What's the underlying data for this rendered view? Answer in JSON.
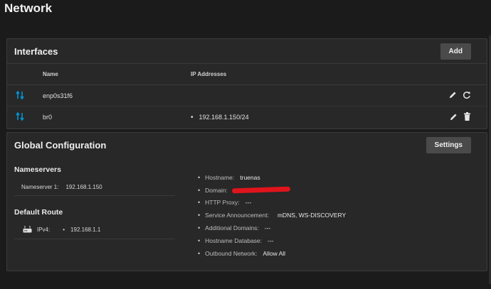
{
  "page": {
    "title": "Network"
  },
  "interfaces": {
    "title": "Interfaces",
    "add_label": "Add",
    "columns": {
      "name": "Name",
      "ip": "IP Addresses"
    },
    "rows": [
      {
        "name": "enp0s31f6",
        "ip": ""
      },
      {
        "name": "br0",
        "ip": "192.168.1.150/24"
      }
    ]
  },
  "global": {
    "title": "Global Configuration",
    "settings_label": "Settings",
    "nameservers": {
      "title": "Nameservers",
      "items": [
        {
          "label": "Nameserver 1:",
          "value": "192.168.1.150"
        }
      ]
    },
    "default_route": {
      "title": "Default Route",
      "label": "IPv4:",
      "value": "192.168.1.1"
    },
    "details": {
      "hostname": {
        "label": "Hostname:",
        "value": "truenas"
      },
      "domain": {
        "label": "Domain:"
      },
      "http_proxy": {
        "label": "HTTP Proxy:",
        "value": "---"
      },
      "service_announcement": {
        "label": "Service Announcement:",
        "value": "mDNS, WS-DISCOVERY"
      },
      "additional_domains": {
        "label": "Additional Domains:",
        "value": "---"
      },
      "hostname_database": {
        "label": "Hostname Database:",
        "value": "---"
      },
      "outbound_network": {
        "label": "Outbound Network:",
        "value": "Allow All"
      }
    }
  },
  "colors": {
    "accent": "#0095d5",
    "redaction": "#e0141c"
  }
}
